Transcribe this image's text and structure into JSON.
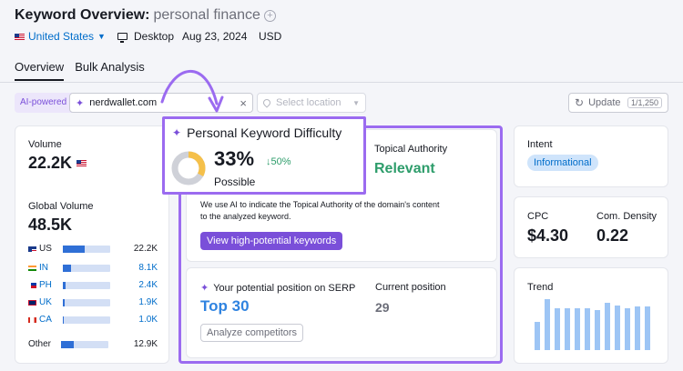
{
  "header": {
    "title": "Keyword Overview:",
    "keyword": "personal finance",
    "country": "United States",
    "device": "Desktop",
    "date": "Aug 23, 2024",
    "currency": "USD"
  },
  "tabs": [
    {
      "label": "Overview",
      "active": true
    },
    {
      "label": "Bulk Analysis",
      "active": false
    }
  ],
  "search": {
    "ai_badge": "AI-powered",
    "domain": "nerdwallet.com",
    "location_placeholder": "Select location",
    "update_label": "Update",
    "update_count": "1/1,250"
  },
  "volume": {
    "label": "Volume",
    "value": "22.2K",
    "global_label": "Global Volume",
    "global_value": "48.5K",
    "rows": [
      {
        "code": "US",
        "value": "22.2K",
        "fill": 0.46,
        "link": false
      },
      {
        "code": "IN",
        "value": "8.1K",
        "fill": 0.17,
        "link": true
      },
      {
        "code": "PH",
        "value": "2.4K",
        "fill": 0.05,
        "link": true
      },
      {
        "code": "UK",
        "value": "1.9K",
        "fill": 0.04,
        "link": true
      },
      {
        "code": "CA",
        "value": "1.0K",
        "fill": 0.02,
        "link": true
      }
    ],
    "other_label": "Other",
    "other_value": "12.9K",
    "other_fill": 0.27
  },
  "pkd": {
    "title": "Personal Keyword Difficulty",
    "value": "33%",
    "change": "50%",
    "label": "Possible",
    "percent": 33
  },
  "topical": {
    "label": "Topical Authority",
    "value": "Relevant",
    "description_line1": "We use AI to indicate the Topical Authority of the domain's content",
    "description_line2": "to the analyzed keyword.",
    "button": "View high-potential keywords"
  },
  "serp": {
    "label": "Your potential position on SERP",
    "value": "Top 30",
    "current_label": "Current position",
    "current_value": "29",
    "button": "Analyze competitors"
  },
  "intent": {
    "label": "Intent",
    "value": "Informational"
  },
  "cpc": {
    "label": "CPC",
    "value": "$4.30",
    "comp_label": "Com. Density",
    "comp_value": "0.22"
  },
  "trend": {
    "label": "Trend",
    "values": [
      0.55,
      1.0,
      0.83,
      0.83,
      0.83,
      0.83,
      0.78,
      0.92,
      0.88,
      0.83,
      0.85,
      0.85
    ]
  },
  "colors": {
    "accent": "#9b6bf0",
    "link": "#006dca",
    "green": "#2e9d6b",
    "gauge": "#f5c04a"
  }
}
